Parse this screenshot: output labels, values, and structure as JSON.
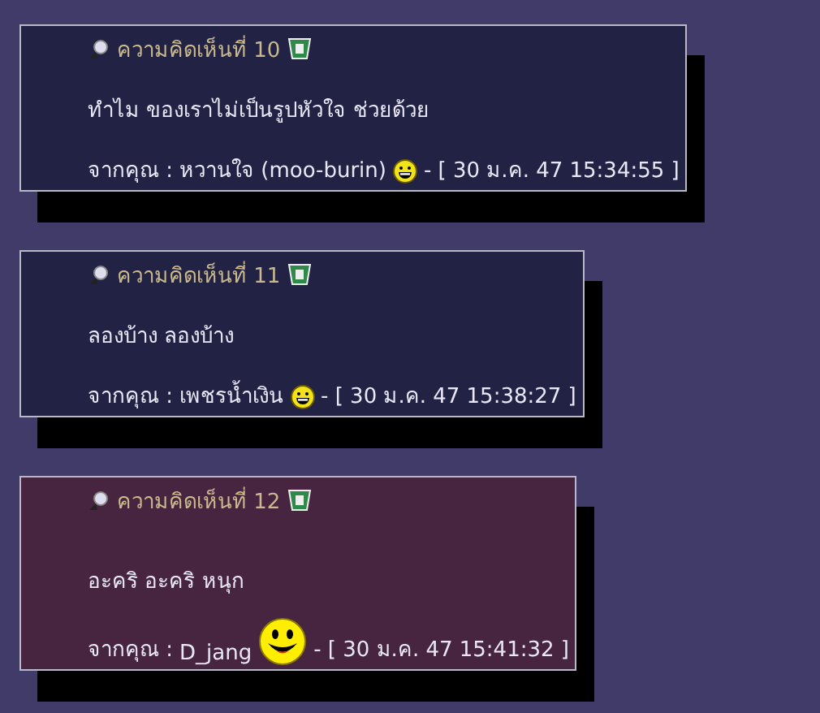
{
  "comments": [
    {
      "title": "ความคิดเห็นที่ 10",
      "body": "ทำไม ของเราไม่เป็นรูปหัวใจ ช่วยด้วย",
      "from_label": "จากคุณ :",
      "author": "หวานใจ (moo-burin)",
      "smiley": {
        "kind": "grin"
      },
      "timestamp": "- [ 30 ม.ค. 47 15:34:55 ]",
      "color": "#222244"
    },
    {
      "title": "ความคิดเห็นที่ 11",
      "body": "ลองบ้าง ลองบ้าง",
      "from_label": "จากคุณ :",
      "author": "เพชรน้ำเงิน",
      "smiley": {
        "kind": "grin"
      },
      "timestamp": "- [ 30 ม.ค. 47 15:38:27 ]",
      "color": "#222244"
    },
    {
      "title": "ความคิดเห็นที่ 12",
      "body": "อะคริ อะคริ หนุก",
      "from_label": "จากคุณ :",
      "author": "D_jang",
      "smiley": {
        "kind": "big_smile"
      },
      "timestamp": "- [ 30 ม.ค. 47 15:41:32 ]",
      "color": "#472440"
    }
  ]
}
